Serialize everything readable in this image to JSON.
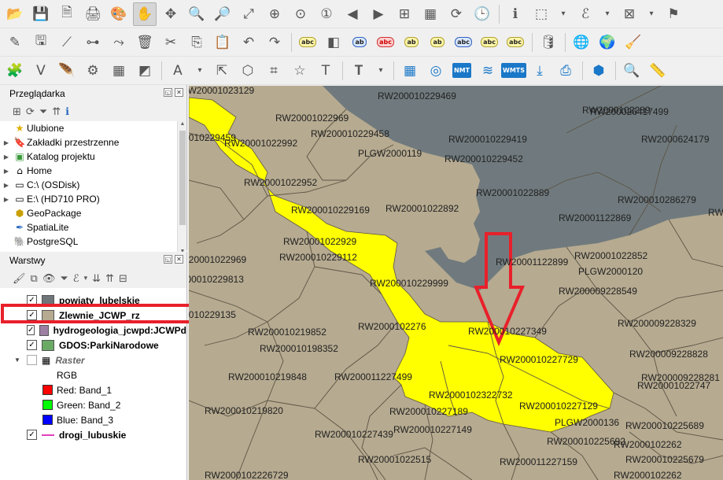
{
  "toolbar": {
    "row1_icons": [
      "open-folder-icon",
      "save-icon",
      "save-as-icon",
      "print-layout-icon",
      "style-manager-icon",
      "pan-icon",
      "pan-to-selection-icon",
      "zoom-in-icon",
      "zoom-out-icon",
      "zoom-full-icon",
      "zoom-to-selection-icon",
      "zoom-to-layer-icon",
      "zoom-native-icon",
      "zoom-last-icon",
      "zoom-next-icon",
      "new-bookmark-icon",
      "show-bookmarks-icon",
      "refresh-icon",
      "temporal-icon",
      "identify-icon",
      "select-features-icon",
      "deselect-icon",
      "field-calculator-icon",
      "attribute-table-icon",
      "statistics-icon",
      "measure-icon",
      "annotation-icon"
    ],
    "row2_icons": [
      "edit-pencil-icon",
      "save-edits-icon",
      "digitize-icon",
      "vertex-tool-icon",
      "node-tool-icon",
      "delete-selected-icon",
      "cut-features-icon",
      "copy-features-icon",
      "paste-features-icon",
      "undo-icon",
      "redo-icon",
      "label-icon",
      "label-pin-icon",
      "label-highlight-icon",
      "label-red-icon",
      "label-show-icon",
      "label-move-icon",
      "label-rotate-icon",
      "label-change-icon",
      "label-pin-all-icon",
      "database-icon",
      "wms-icon",
      "wfs-icon",
      "plugin-icon"
    ],
    "row3_icons": [
      "georeference-icon",
      "vertex-editor-icon",
      "trace-icon",
      "processing-icon",
      "grid-icon",
      "reshape-icon",
      "text-label-icon",
      "select-arrow-icon",
      "polygon-edit-icon",
      "split-icon",
      "star-icon",
      "text-tool-icon",
      "text-annotation-icon",
      "layout-icon",
      "circle-icon",
      "nmt-icon",
      "layers-stack-icon",
      "wmts-icon",
      "download-icon",
      "print-icon",
      "cube-icon",
      "search-map-icon",
      "measure-line-icon"
    ],
    "nmt_label": "NMT",
    "wmts_label": "WMTS"
  },
  "browser_panel": {
    "title": "Przeglądarka",
    "items": [
      {
        "label": "Ulubione",
        "icon": "star-icon",
        "has_arrow": false
      },
      {
        "label": "Zakładki przestrzenne",
        "icon": "bookmark-icon",
        "has_arrow": true
      },
      {
        "label": "Katalog projektu",
        "icon": "project-folder-icon",
        "has_arrow": true
      },
      {
        "label": "Home",
        "icon": "home-icon",
        "has_arrow": true
      },
      {
        "label": "C:\\ (OSDisk)",
        "icon": "drive-icon",
        "has_arrow": true
      },
      {
        "label": "E:\\ (HD710 PRO)",
        "icon": "drive-icon",
        "has_arrow": true
      },
      {
        "label": "GeoPackage",
        "icon": "geopackage-icon",
        "has_arrow": false
      },
      {
        "label": "SpatiaLite",
        "icon": "spatialite-icon",
        "has_arrow": false
      },
      {
        "label": "PostgreSQL",
        "icon": "postgresql-icon",
        "has_arrow": false
      }
    ]
  },
  "layers_panel": {
    "title": "Warstwy",
    "layers": [
      {
        "label": "powiaty_lubelskie",
        "checked": true,
        "swatch": "#6f7579"
      },
      {
        "label": "Zlewnie_JCWP_rz",
        "checked": true,
        "swatch": "#b6aa90"
      },
      {
        "label": "hydrogeologia_jcwpd:JCWPd",
        "checked": true,
        "swatch": "#9d7fa3"
      },
      {
        "label": "GDOS:ParkiNarodowe",
        "checked": true,
        "swatch": "#6aaa64"
      }
    ],
    "raster": {
      "label": "Raster",
      "sub": "RGB",
      "bands": [
        {
          "label": "Red:   Band_1",
          "color": "#ff0000"
        },
        {
          "label": "Green: Band_2",
          "color": "#00ff00"
        },
        {
          "label": "Blue:  Band_3",
          "color": "#0000ff"
        }
      ]
    },
    "roads": {
      "label": "drogi_lubuskie",
      "checked": true,
      "color": "#e040c0"
    }
  },
  "map": {
    "colors": {
      "land": "#b6aa90",
      "water": "#707a7e",
      "selected": "#ffff00",
      "border": "#5c5444",
      "arrow": "#e8202a"
    },
    "labels": [
      "RW20001023129",
      "RW200010229469",
      "RW2000102289",
      "RW200010229459",
      "RW20001022969",
      "RW200010229458",
      "RW200010229419",
      "RW20001022992",
      "PLGW2000119",
      "RW200010229452",
      "RW20001022952",
      "RW20001022889",
      "RW200010229169",
      "RW20001022892",
      "RW20001122869",
      "RW20001022929",
      "RW20001122899",
      "RW200010229112",
      "RW200010229999",
      "RW20001022969",
      "RW200010229813",
      "RW20001022852",
      "PLGW2000120",
      "RW200009228549",
      "RW200010229135",
      "RW200010227349",
      "RW200009228329",
      "RW200010219852",
      "RW2000102276",
      "RW200010198352",
      "RW200010227729",
      "RW200009228828",
      "RW200010219848",
      "RW200011227499",
      "RW2000102322732",
      "RW200009228281",
      "RW20001022747",
      "RW200010227129",
      "RW200010219820",
      "RW200010227189",
      "PLGW2000136",
      "RW200010225689",
      "RW200010227439",
      "RW200010227149",
      "RW200010225692",
      "RW2000102262",
      "RW2000102226729",
      "RW20001022515",
      "RW200011227159",
      "RW200010225679",
      "RW2000102262",
      "RW200026417499",
      "RW2000624179",
      "RW200010286279",
      "RW20001122869"
    ]
  }
}
